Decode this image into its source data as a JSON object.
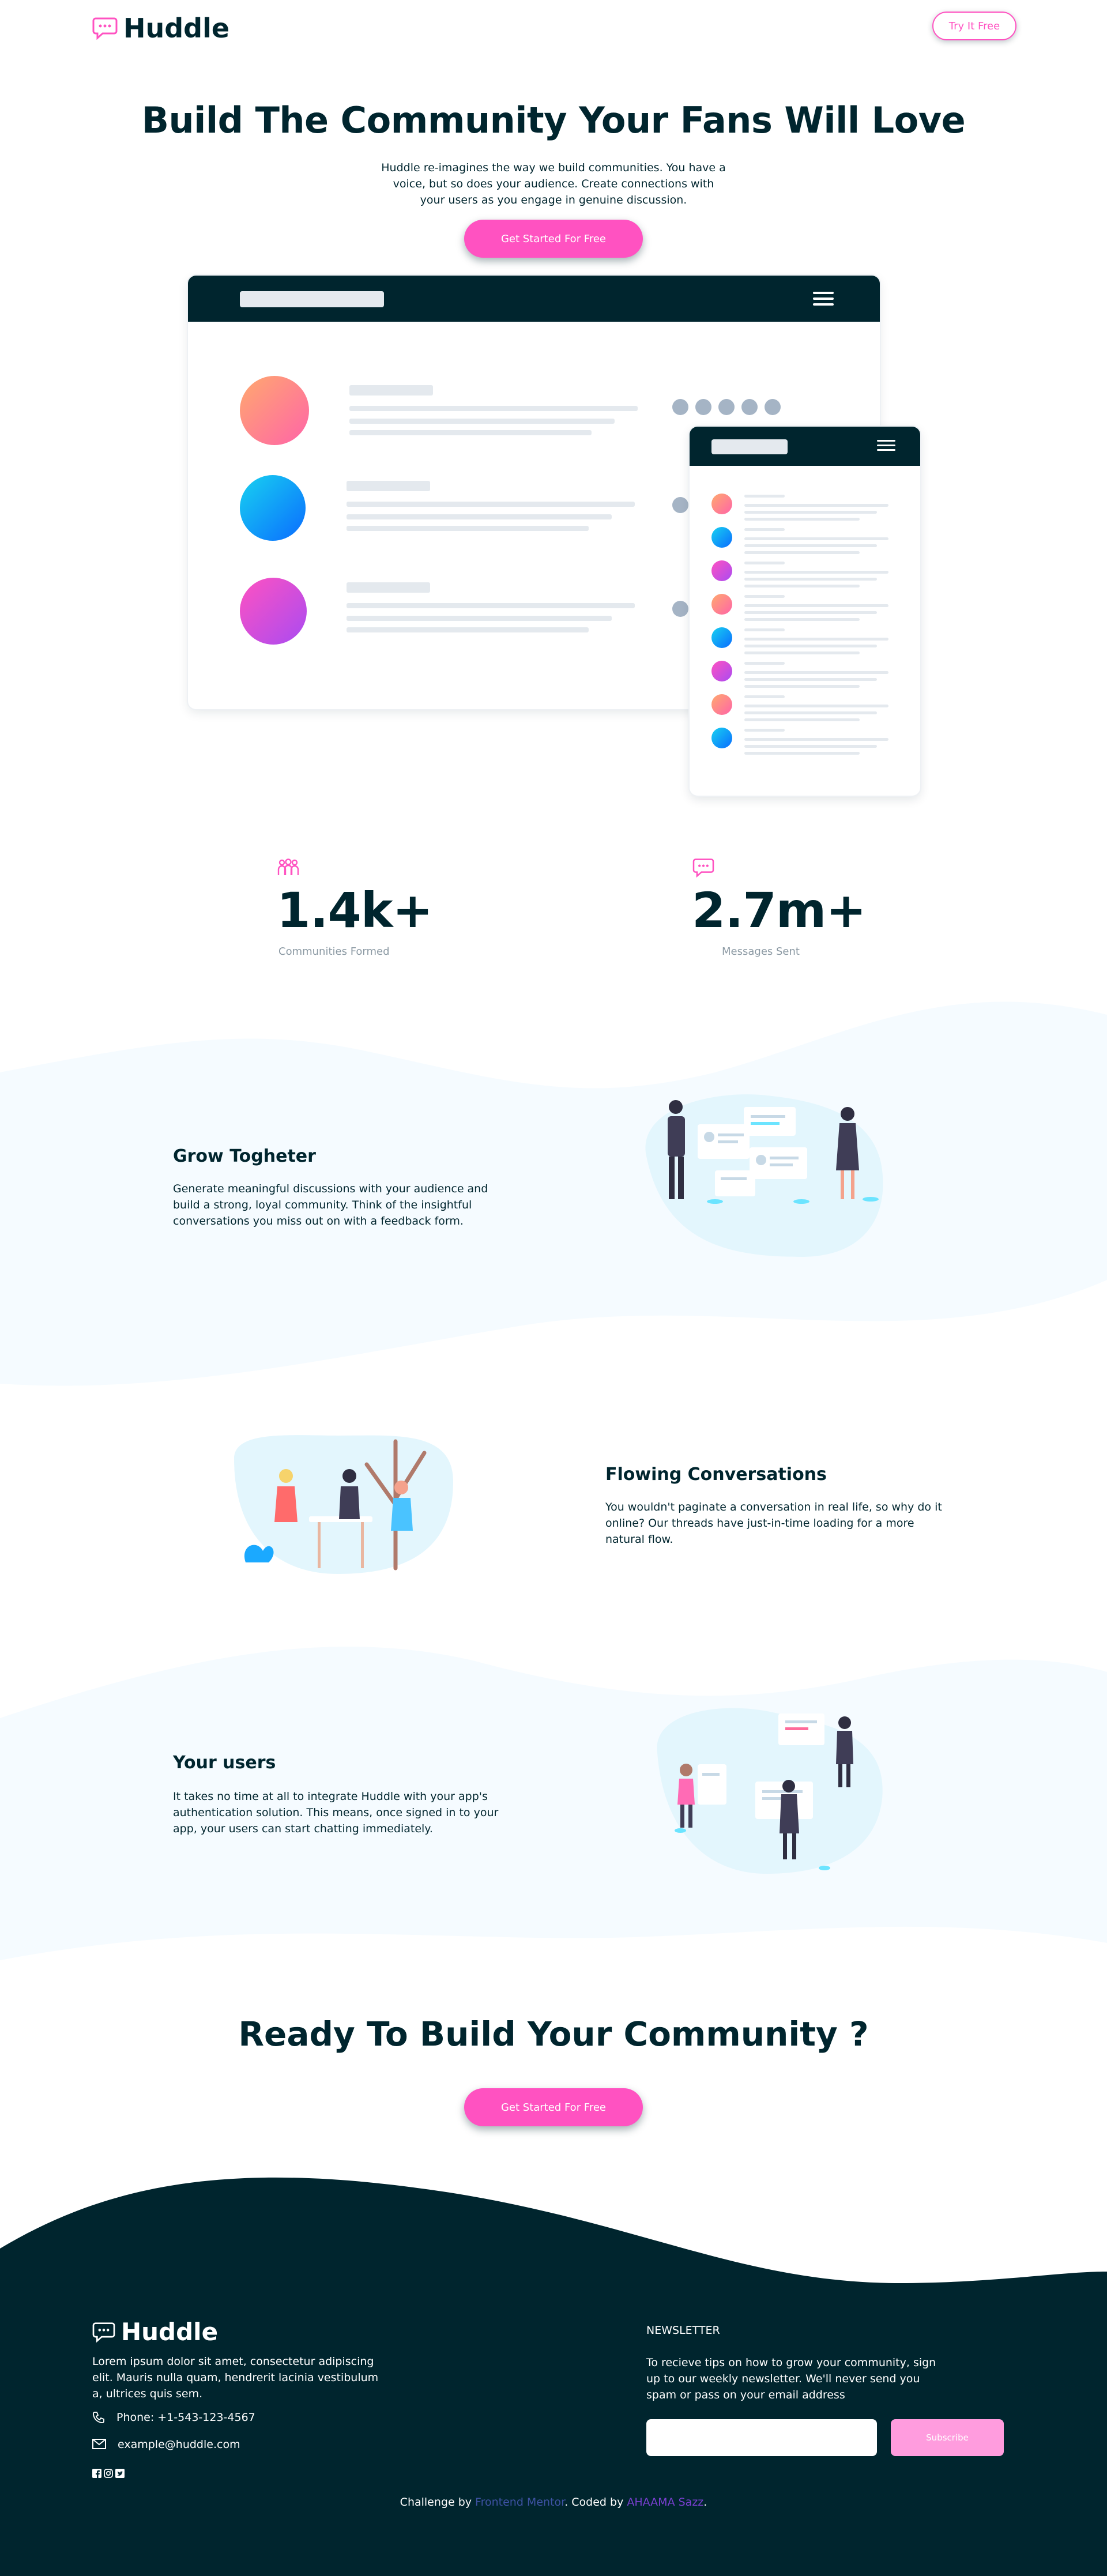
{
  "brand": {
    "name": "Huddle",
    "accent": "#ff52c1",
    "dark": "#00252e",
    "light_blue": "#f5fbff"
  },
  "header": {
    "try_label": "Try It Free"
  },
  "hero": {
    "title": "Build The Community Your Fans Will Love",
    "text": "Huddle re-imagines the way we build communities. You have a voice, but so does your audience. Create connections with your users as you engage in genuine discussion.",
    "cta_label": "Get Started For Free"
  },
  "stats": [
    {
      "icon": "communities-icon",
      "value": "1.4k+",
      "label": "Communities Formed"
    },
    {
      "icon": "messages-icon",
      "value": "2.7m+",
      "label": "Messages Sent"
    }
  ],
  "features": [
    {
      "title": "Grow Togheter",
      "text": "Generate meaningful discussions with your audience and build a strong, loyal community. Think of the insightful conversations you miss out on with a feedback form."
    },
    {
      "title": "Flowing Conversations",
      "text": "You wouldn't paginate a conversation in real life, so why do it online? Our threads have just-in-time loading for a more natural flow."
    },
    {
      "title": "Your users",
      "text": "It takes no time at all to integrate Huddle with your app's authentication solution. This means, once signed in to your app, your users can start chatting immediately."
    }
  ],
  "ready": {
    "title": "Ready To Build Your Community ?",
    "cta_label": "Get Started For Free"
  },
  "footer": {
    "about": "Lorem ipsum dolor sit amet, consectetur adipiscing elit. Mauris nulla quam, hendrerit lacinia vestibulum a, ultrices quis sem.",
    "phone": "Phone: +1-543-123-4567",
    "email": "example@huddle.com",
    "newsletter_title": "NEWSLETTER",
    "newsletter_text": "To recieve tips on how to grow your community, sign up to our weekly newsletter. We'll never send you spam or pass on your email address",
    "subscribe_label": "Subscribe",
    "credit_prefix": "Challenge by ",
    "credit_fm": "Frontend Mentor",
    "credit_mid": ". Coded by ",
    "credit_author": "AHAAMA Sazz",
    "credit_suffix": "."
  }
}
